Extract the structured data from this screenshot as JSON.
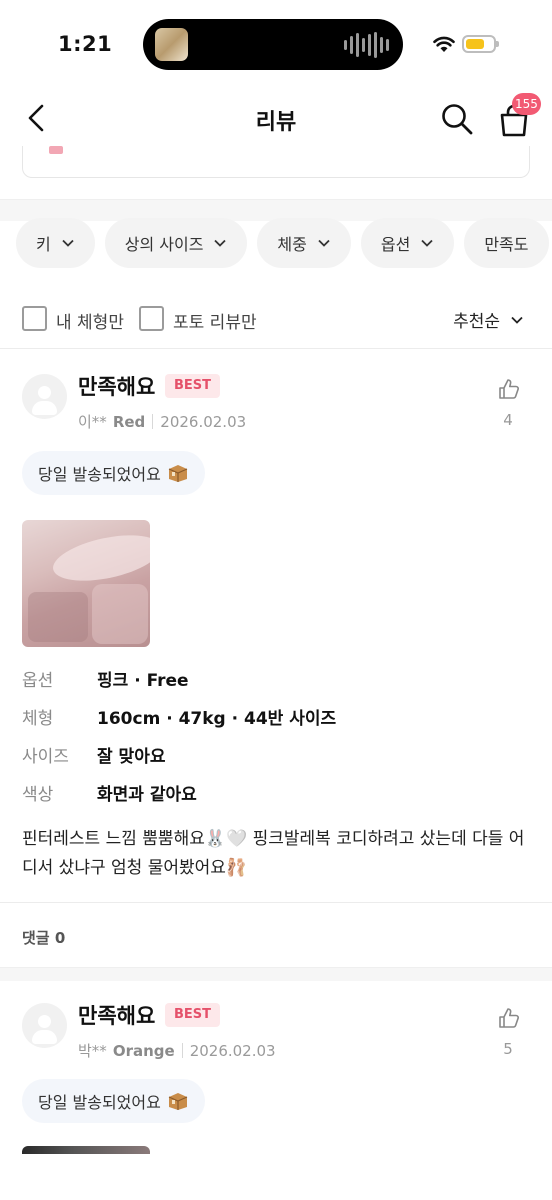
{
  "status_bar": {
    "time": "1:21"
  },
  "header": {
    "title": "리뷰",
    "cart_badge": "155"
  },
  "filters": [
    {
      "label": "키"
    },
    {
      "label": "상의 사이즈"
    },
    {
      "label": "체중"
    },
    {
      "label": "옵션"
    },
    {
      "label": "만족도"
    }
  ],
  "toggles": {
    "my_body": "내 체형만",
    "photo_only": "포토 리뷰만",
    "sort": "추천순"
  },
  "reviews": [
    {
      "title": "만족해요",
      "badge": "BEST",
      "user": "이**",
      "color": "Red",
      "date": "2026.02.03",
      "likes": "4",
      "shipping_tag": "당일 발송되었어요",
      "specs": [
        {
          "key": "옵션",
          "value": "핑크 · Free"
        },
        {
          "key": "체형",
          "value": "160cm · 47kg · 44반 사이즈"
        },
        {
          "key": "사이즈",
          "value": "잘 맞아요"
        },
        {
          "key": "색상",
          "value": "화면과 같아요"
        }
      ],
      "body": "핀터레스트 느낌 뿜뿜해요🐰🤍 핑크발레복 코디하려고 샀는데 다들 어디서 샀냐구 엄청 물어봤어요🩰",
      "comments": "댓글 0"
    },
    {
      "title": "만족해요",
      "badge": "BEST",
      "user": "박**",
      "color": "Orange",
      "date": "2026.02.03",
      "likes": "5",
      "shipping_tag": "당일 발송되었어요"
    }
  ],
  "colors": {
    "badge_bg": "#fde8ea",
    "badge_text": "#e5516a",
    "cart_badge": "#f25a73",
    "battery": "#f6c31b"
  }
}
